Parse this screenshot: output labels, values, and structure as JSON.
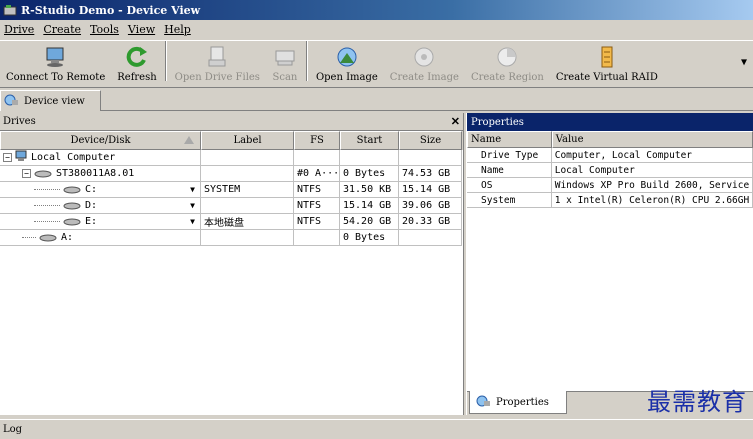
{
  "window": {
    "title": "R-Studio Demo - Device View"
  },
  "menu": [
    "Drive",
    "Create",
    "Tools",
    "View",
    "Help"
  ],
  "toolbar": {
    "buttons": [
      {
        "label": "Connect To Remote",
        "icon": "connect-remote-icon",
        "enabled": true
      },
      {
        "label": "Refresh",
        "icon": "refresh-icon",
        "enabled": true
      },
      {
        "label": "Open Drive Files",
        "icon": "open-drive-files-icon",
        "enabled": false
      },
      {
        "label": "Scan",
        "icon": "scan-icon",
        "enabled": false
      },
      {
        "label": "Open Image",
        "icon": "open-image-icon",
        "enabled": true
      },
      {
        "label": "Create Image",
        "icon": "create-image-icon",
        "enabled": false
      },
      {
        "label": "Create Region",
        "icon": "create-region-icon",
        "enabled": false
      },
      {
        "label": "Create Virtual RAID",
        "icon": "create-virtual-raid-icon",
        "enabled": true
      }
    ]
  },
  "tabs": {
    "device_view": "Device view"
  },
  "drives": {
    "title": "Drives",
    "columns": [
      "Device/Disk",
      "Label",
      "FS",
      "Start",
      "Size"
    ],
    "rows": [
      {
        "device": "Local Computer",
        "label": "",
        "fs": "",
        "start": "",
        "size": ""
      },
      {
        "device": "ST380011A8.01",
        "label": "",
        "fs": "#0 A···",
        "start": "0 Bytes",
        "size": "74.53 GB"
      },
      {
        "device": "C:",
        "label": "SYSTEM",
        "fs": "NTFS",
        "start": "31.50 KB",
        "size": "15.14 GB"
      },
      {
        "device": "D:",
        "label": "",
        "fs": "NTFS",
        "start": "15.14 GB",
        "size": "39.06 GB"
      },
      {
        "device": "E:",
        "label": "本地磁盘",
        "fs": "NTFS",
        "start": "54.20 GB",
        "size": "20.33 GB"
      },
      {
        "device": "A:",
        "label": "",
        "fs": "",
        "start": "0 Bytes",
        "size": ""
      }
    ]
  },
  "properties": {
    "title": "Properties",
    "columns": [
      "Name",
      "Value"
    ],
    "rows": [
      {
        "name": "Drive Type",
        "value": "Computer, Local Computer"
      },
      {
        "name": "Name",
        "value": "Local Computer"
      },
      {
        "name": "OS",
        "value": "Windows XP Pro Build 2600, Service"
      },
      {
        "name": "System",
        "value": "1 x Intel(R) Celeron(R) CPU 2.66GH"
      }
    ],
    "tab_label": "Properties"
  },
  "log": {
    "label": "Log"
  },
  "watermark": "最需教育",
  "colors": {
    "title_bar": "#0a246a",
    "window_bg": "#d4d0c8",
    "watermark": "#1a2fa8"
  }
}
